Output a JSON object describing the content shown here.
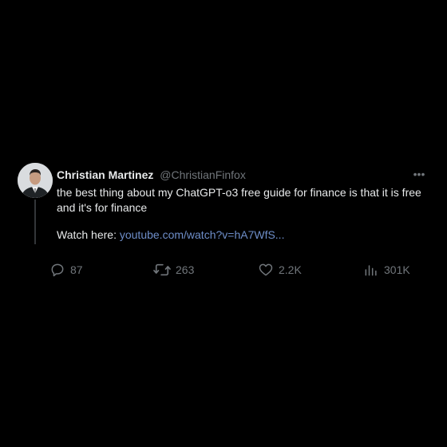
{
  "tweet": {
    "author_name": "Christian Martinez",
    "author_handle": "@ChristianFinfox",
    "text": "the best thing about my ChatGPT-o3 free guide for finance is that it is free and it's for finance",
    "watch_label": "Watch here:",
    "link_text": "youtube.com/watch?v=hA7WfS...",
    "more_icon": "•••"
  },
  "actions": {
    "replies": {
      "icon": "reply-icon",
      "count": "87"
    },
    "retweets": {
      "icon": "retweet-icon",
      "count": "263"
    },
    "likes": {
      "icon": "heart-icon",
      "count": "2.2K"
    },
    "views": {
      "icon": "views-icon",
      "count": "301K"
    }
  },
  "colors": {
    "background": "#000000",
    "text": "#e7e9ea",
    "muted": "#71767b",
    "link": "#6e8ec9",
    "thread_line": "#333639"
  }
}
